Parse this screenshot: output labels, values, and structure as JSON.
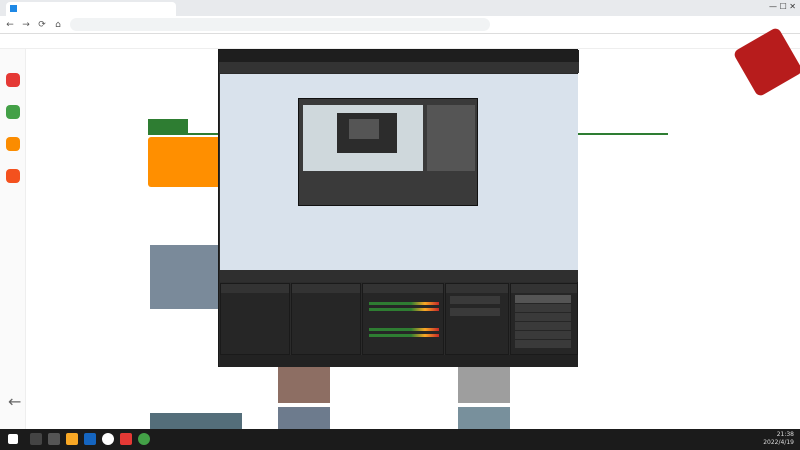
{
  "browser": {
    "tab_title": "",
    "url": "",
    "window_controls": "—  ☐  ✕"
  },
  "bookmarks": [],
  "sidebar": {
    "items": [
      {
        "color": "#e53935"
      },
      {
        "color": "#43a047"
      },
      {
        "color": "#fb8c00"
      },
      {
        "color": "#f4511e"
      }
    ]
  },
  "page": {
    "logo": "",
    "login": "",
    "nav": [],
    "banner": "",
    "links_right": [],
    "news": [],
    "colors": {
      "accent": "#2e7d32",
      "overlay": "#ff2020"
    }
  },
  "obs": {
    "title": "",
    "menu": [],
    "overlay_text": "",
    "control_bar": "",
    "docks": {
      "scenes": {
        "header": "",
        "items": []
      },
      "sources": {
        "header": "",
        "items": []
      },
      "mixer": {
        "header": "",
        "channels": []
      },
      "transitions": {
        "header": "",
        "type": "",
        "duration": ""
      },
      "controls": {
        "header": "",
        "buttons": []
      }
    },
    "status": ""
  },
  "overlay": {
    "red_text": ""
  },
  "taskbar": {
    "time": "21:38",
    "date": "2022/4/19"
  }
}
